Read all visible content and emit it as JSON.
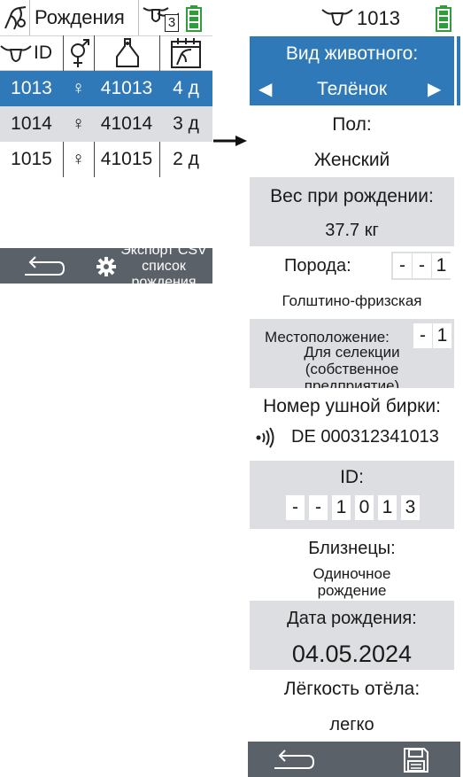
{
  "left": {
    "title": "Рождения",
    "header_icons": [
      "cow-birth-icon",
      "cow-group-icon",
      "battery-icon"
    ],
    "cow_count_badge": "3",
    "columns": [
      "ID"
    ],
    "column_icons": [
      "cow-head-icon",
      "gender-icon",
      "ear-tag-icon",
      "calendar-birth-icon"
    ],
    "rows": [
      {
        "id": "1013",
        "sex": "♀",
        "tag": "41013",
        "age": "4 д",
        "selected": true
      },
      {
        "id": "1014",
        "sex": "♀",
        "tag": "41014",
        "age": "3 д",
        "selected": false
      },
      {
        "id": "1015",
        "sex": "♀",
        "tag": "41015",
        "age": "2 д",
        "selected": false
      }
    ],
    "footer": {
      "back_icon": "back-icon",
      "settings_icon": "gear-icon",
      "export_lines": [
        "Экспорт CSV",
        "список",
        "рождения"
      ]
    }
  },
  "arrow": "arrow-right-icon",
  "right": {
    "title": "1013",
    "header_icons": [
      "cow-head-icon",
      "battery-icon"
    ],
    "animal_type": {
      "label": "Вид животного:",
      "value": "Телёнок",
      "prev": "◀",
      "next": "▶"
    },
    "sex": {
      "label": "Пол:",
      "value": "Женский"
    },
    "birth_weight": {
      "label": "Вес при рождении:",
      "value": "37.7 кг"
    },
    "breed": {
      "label": "Порода:",
      "code": [
        "-",
        "-",
        "1"
      ],
      "value": "Голштино-фризская"
    },
    "location": {
      "label": "Местоположение:",
      "code": [
        "-",
        "1"
      ],
      "value_lines": [
        "Для селекции",
        "(собственное",
        "предприятие)"
      ]
    },
    "ear_tag": {
      "label": "Номер ушной бирки:",
      "value": "DE 000312341013",
      "icon": "rfid-icon"
    },
    "id": {
      "label": "ID:",
      "digits": [
        "-",
        "-",
        "1",
        "0",
        "1",
        "3"
      ]
    },
    "twins": {
      "label": "Близнецы:",
      "value_lines": [
        "Одиночное",
        "рождение"
      ]
    },
    "birth_date": {
      "label": "Дата рождения:",
      "value": "04.05.2024"
    },
    "calving_ease": {
      "label": "Лёгкость отёла:",
      "value": "легко"
    },
    "footer": {
      "back_icon": "back-icon",
      "save_icon": "save-icon"
    }
  }
}
